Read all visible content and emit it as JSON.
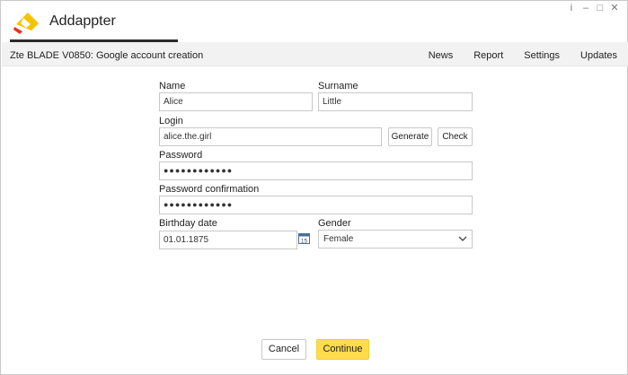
{
  "app": {
    "name": "Addappter",
    "window_controls": {
      "info": "i",
      "minimize": "–",
      "maximize": "□",
      "close": "✕"
    }
  },
  "header": {
    "title": "Zte BLADE V0850: Google account creation",
    "nav": [
      "News",
      "Report",
      "Settings",
      "Updates"
    ]
  },
  "form": {
    "name_label": "Name",
    "name_value": "Alice",
    "surname_label": "Surname",
    "surname_value": "Little",
    "login_label": "Login",
    "login_value": "alice.the.girl",
    "generate_label": "Generate",
    "check_label": "Check",
    "password_label": "Password",
    "password_value": "●●●●●●●●●●●●",
    "password_confirm_label": "Password confirmation",
    "password_confirm_value": "●●●●●●●●●●●●",
    "birthday_label": "Birthday date",
    "birthday_value": "01.01.1875",
    "calendar_day": "15",
    "gender_label": "Gender",
    "gender_value": "Female"
  },
  "footer": {
    "cancel_label": "Cancel",
    "continue_label": "Continue"
  },
  "colors": {
    "logo_yellow": "#f5c400",
    "logo_red": "#e8321b",
    "primary_button": "#ffdb4d",
    "toolbar_bg": "#f2f2f2"
  }
}
